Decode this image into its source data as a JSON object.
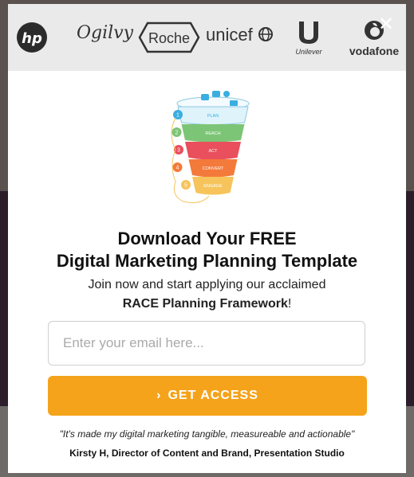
{
  "logos": {
    "hp": "hp",
    "ogilvy": "Ogilvy",
    "roche": "Roche",
    "unicef": "unicef",
    "unilever": "Unilever",
    "vodafone": "vodafone"
  },
  "close_glyph": "✕",
  "funnel": {
    "stages": [
      {
        "n": "1",
        "label": "PLAN",
        "color": "#dff3fb"
      },
      {
        "n": "2",
        "label": "REACH",
        "color": "#7cc576"
      },
      {
        "n": "3",
        "label": "ACT",
        "color": "#e94f5c"
      },
      {
        "n": "4",
        "label": "CONVERT",
        "color": "#f37a3a"
      },
      {
        "n": "5",
        "label": "ENGAGE",
        "color": "#f6c45a"
      }
    ]
  },
  "headline": {
    "line1": "Download Your FREE",
    "line2": "Digital Marketing Planning Template"
  },
  "sub": {
    "line1": "Join now and start applying our acclaimed",
    "bold": "RACE Planning Framework",
    "suffix": "!"
  },
  "form": {
    "email_placeholder": "Enter your email here...",
    "cta_label": "GET ACCESS",
    "cta_chevron": "›"
  },
  "testimonial": {
    "quote": "\"It's made my digital marketing tangible, measureable and actionable\"",
    "author": "Kirsty H, Director of Content and Brand, Presentation Studio"
  },
  "colors": {
    "cta": "#f5a31b",
    "logo_strip": "#eaeaea"
  }
}
